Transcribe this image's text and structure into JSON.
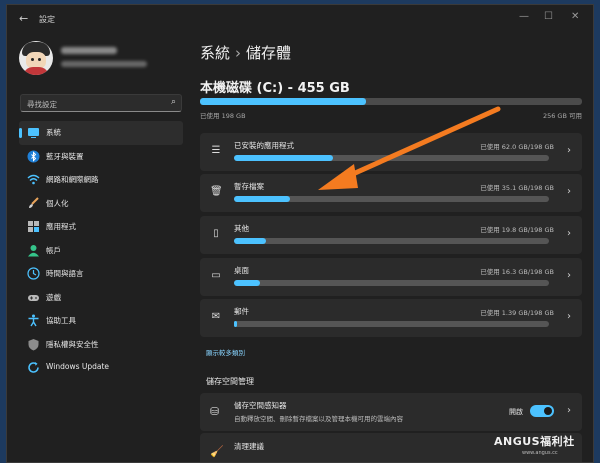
{
  "window": {
    "title": "設定"
  },
  "sidebar": {
    "search_placeholder": "尋找設定",
    "items": [
      {
        "label": "系統",
        "icon": "monitor-icon",
        "active": true
      },
      {
        "label": "藍牙與裝置",
        "icon": "bluetooth-icon"
      },
      {
        "label": "網路和網際網路",
        "icon": "wifi-icon"
      },
      {
        "label": "個人化",
        "icon": "brush-icon"
      },
      {
        "label": "應用程式",
        "icon": "apps-icon"
      },
      {
        "label": "帳戶",
        "icon": "person-icon"
      },
      {
        "label": "時間與語言",
        "icon": "globe-clock-icon"
      },
      {
        "label": "遊戲",
        "icon": "gamepad-icon"
      },
      {
        "label": "協助工具",
        "icon": "accessibility-icon"
      },
      {
        "label": "隱私權與安全性",
        "icon": "shield-icon"
      },
      {
        "label": "Windows Update",
        "icon": "update-icon"
      }
    ]
  },
  "breadcrumb": {
    "parent": "系統",
    "separator": "›",
    "current": "儲存體"
  },
  "drive": {
    "title": "本機磁碟 (C:) - 455 GB",
    "used_label": "已使用 198 GB",
    "free_label": "256 GB 可用",
    "used_fraction": 0.435
  },
  "categories": [
    {
      "name": "已安裝的應用程式",
      "usage": "已使用 62.0 GB/198 GB",
      "fraction": 0.313,
      "icon": "list-icon"
    },
    {
      "name": "暫存檔案",
      "usage": "已使用 35.1 GB/198 GB",
      "fraction": 0.177,
      "icon": "trash-icon"
    },
    {
      "name": "其他",
      "usage": "已使用 19.8 GB/198 GB",
      "fraction": 0.1,
      "icon": "file-icon"
    },
    {
      "name": "桌面",
      "usage": "已使用 16.3 GB/198 GB",
      "fraction": 0.082,
      "icon": "desktop-icon"
    },
    {
      "name": "郵件",
      "usage": "已使用 1.39 GB/198 GB",
      "fraction": 0.007,
      "icon": "mail-icon"
    }
  ],
  "more_link": "顯示較多類別",
  "management": {
    "section_title": "儲存空間管理",
    "storage_sense": {
      "name": "儲存空間感知器",
      "desc": "自動釋放空間、刪除暫存檔案以及管理本機可用的雲端內容",
      "state": "開啟",
      "on": true
    },
    "cleanup": {
      "name": "清理建議"
    }
  },
  "watermark": {
    "brand": "ANGUS福利社",
    "url": "www.angus.cc"
  },
  "colors": {
    "accent": "#4cc2ff",
    "annotation_arrow": "#f47b20"
  }
}
